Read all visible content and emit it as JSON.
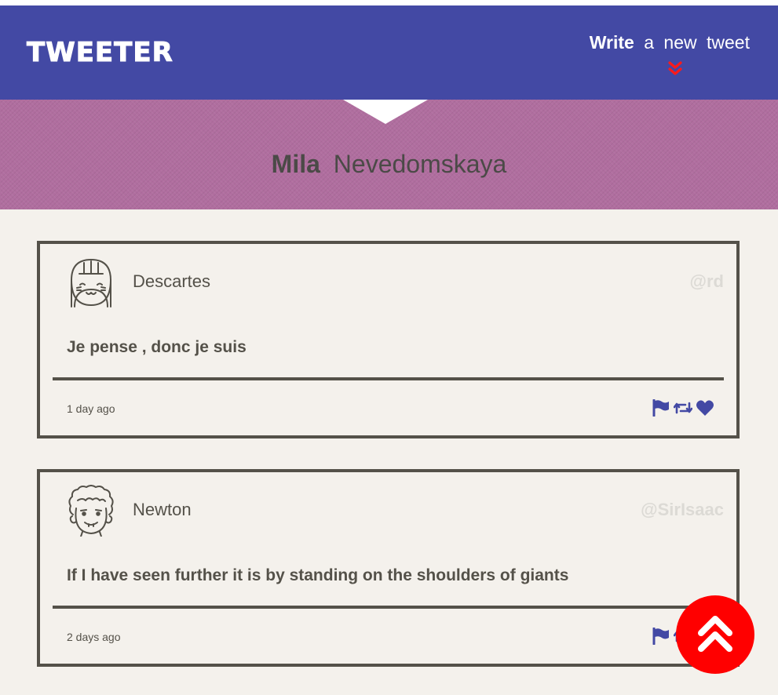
{
  "header": {
    "brand": "TWEETER",
    "compose": {
      "word1": "Write",
      "word2": "a",
      "word3": "new",
      "word4": "tweet"
    }
  },
  "profile": {
    "first_name": "Mila",
    "last_name": "Nevedomskaya"
  },
  "tweets": [
    {
      "name": "Descartes",
      "handle": "@rd",
      "text": "Je pense , donc je suis",
      "time": "1 day ago"
    },
    {
      "name": "Newton",
      "handle": "@SirIsaac",
      "text": "If I have seen further it is by standing on the shoulders of giants",
      "time": "2 days ago"
    }
  ],
  "icons": {
    "compose_arrow": "double-chevron-down-icon",
    "flag": "flag-icon",
    "retweet": "retweet-icon",
    "like": "heart-icon",
    "scroll_top": "double-chevron-up-icon"
  },
  "colors": {
    "navbar": "#4349a4",
    "hero": "#b06e9f",
    "accent_red": "#ff0000",
    "action_icons": "#4349a4",
    "text_dark": "#545149",
    "handle": "#dcdad5",
    "background": "#f4f1ec"
  }
}
